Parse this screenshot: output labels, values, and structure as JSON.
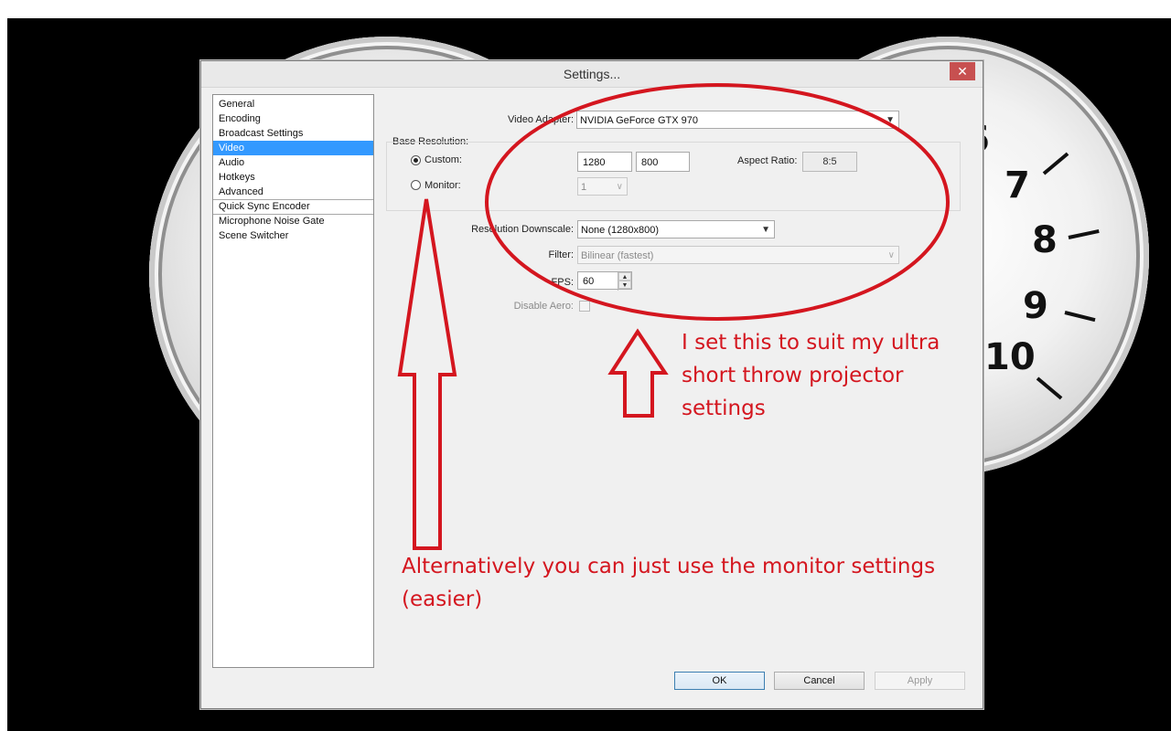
{
  "gauge": {
    "numbers": [
      "6",
      "7",
      "8",
      "9",
      "10"
    ]
  },
  "window": {
    "title": "Settings...",
    "close_glyph": "✕"
  },
  "nav": {
    "items": [
      "General",
      "Encoding",
      "Broadcast Settings",
      "Video",
      "Audio",
      "Hotkeys",
      "Advanced",
      "Quick Sync Encoder",
      "Microphone Noise Gate",
      "Scene Switcher"
    ],
    "selected": "Video"
  },
  "video": {
    "adapter_label": "Video Adapter:",
    "adapter_value": "NVIDIA GeForce GTX 970",
    "base_resolution_label": "Base Resolution:",
    "custom_label": "Custom:",
    "custom_selected": true,
    "width": "1280",
    "height": "800",
    "aspect_label": "Aspect Ratio:",
    "aspect_value": "8:5",
    "monitor_label": "Monitor:",
    "monitor_value": "1",
    "downscale_label": "Resolution Downscale:",
    "downscale_value": "None  (1280x800)",
    "filter_label": "Filter:",
    "filter_value": "Bilinear (fastest)",
    "fps_label": "FPS:",
    "fps_value": "60",
    "aero_label": "Disable Aero:"
  },
  "buttons": {
    "ok": "OK",
    "cancel": "Cancel",
    "apply": "Apply"
  },
  "annotations": {
    "note1": [
      "I set this to suit my ultra",
      "short throw projector",
      "settings"
    ],
    "note2": [
      "Alternatively you can just use the monitor settings",
      "(easier)"
    ],
    "color": "#d4161f"
  }
}
